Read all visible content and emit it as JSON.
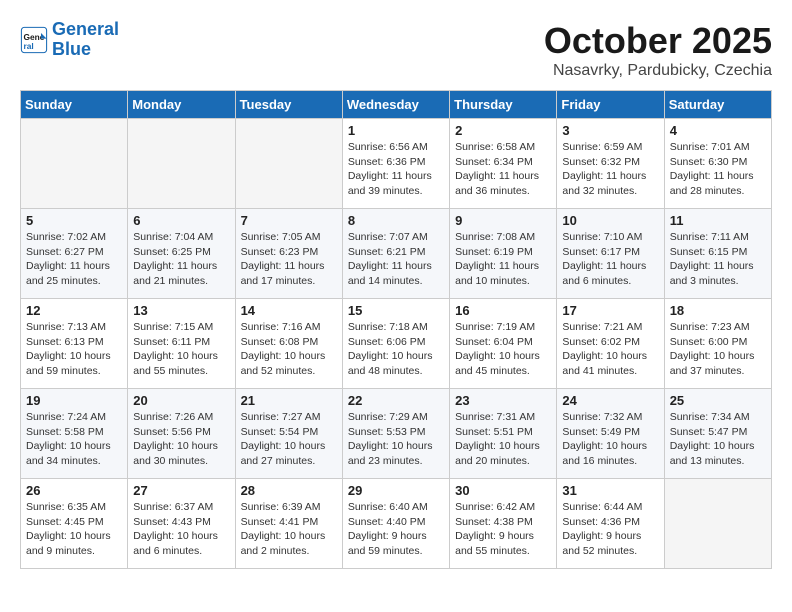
{
  "header": {
    "logo_line1": "General",
    "logo_line2": "Blue",
    "month": "October 2025",
    "location": "Nasavrky, Pardubicky, Czechia"
  },
  "days_of_week": [
    "Sunday",
    "Monday",
    "Tuesday",
    "Wednesday",
    "Thursday",
    "Friday",
    "Saturday"
  ],
  "weeks": [
    [
      {
        "day": "",
        "info": ""
      },
      {
        "day": "",
        "info": ""
      },
      {
        "day": "",
        "info": ""
      },
      {
        "day": "1",
        "info": "Sunrise: 6:56 AM\nSunset: 6:36 PM\nDaylight: 11 hours\nand 39 minutes."
      },
      {
        "day": "2",
        "info": "Sunrise: 6:58 AM\nSunset: 6:34 PM\nDaylight: 11 hours\nand 36 minutes."
      },
      {
        "day": "3",
        "info": "Sunrise: 6:59 AM\nSunset: 6:32 PM\nDaylight: 11 hours\nand 32 minutes."
      },
      {
        "day": "4",
        "info": "Sunrise: 7:01 AM\nSunset: 6:30 PM\nDaylight: 11 hours\nand 28 minutes."
      }
    ],
    [
      {
        "day": "5",
        "info": "Sunrise: 7:02 AM\nSunset: 6:27 PM\nDaylight: 11 hours\nand 25 minutes."
      },
      {
        "day": "6",
        "info": "Sunrise: 7:04 AM\nSunset: 6:25 PM\nDaylight: 11 hours\nand 21 minutes."
      },
      {
        "day": "7",
        "info": "Sunrise: 7:05 AM\nSunset: 6:23 PM\nDaylight: 11 hours\nand 17 minutes."
      },
      {
        "day": "8",
        "info": "Sunrise: 7:07 AM\nSunset: 6:21 PM\nDaylight: 11 hours\nand 14 minutes."
      },
      {
        "day": "9",
        "info": "Sunrise: 7:08 AM\nSunset: 6:19 PM\nDaylight: 11 hours\nand 10 minutes."
      },
      {
        "day": "10",
        "info": "Sunrise: 7:10 AM\nSunset: 6:17 PM\nDaylight: 11 hours\nand 6 minutes."
      },
      {
        "day": "11",
        "info": "Sunrise: 7:11 AM\nSunset: 6:15 PM\nDaylight: 11 hours\nand 3 minutes."
      }
    ],
    [
      {
        "day": "12",
        "info": "Sunrise: 7:13 AM\nSunset: 6:13 PM\nDaylight: 10 hours\nand 59 minutes."
      },
      {
        "day": "13",
        "info": "Sunrise: 7:15 AM\nSunset: 6:11 PM\nDaylight: 10 hours\nand 55 minutes."
      },
      {
        "day": "14",
        "info": "Sunrise: 7:16 AM\nSunset: 6:08 PM\nDaylight: 10 hours\nand 52 minutes."
      },
      {
        "day": "15",
        "info": "Sunrise: 7:18 AM\nSunset: 6:06 PM\nDaylight: 10 hours\nand 48 minutes."
      },
      {
        "day": "16",
        "info": "Sunrise: 7:19 AM\nSunset: 6:04 PM\nDaylight: 10 hours\nand 45 minutes."
      },
      {
        "day": "17",
        "info": "Sunrise: 7:21 AM\nSunset: 6:02 PM\nDaylight: 10 hours\nand 41 minutes."
      },
      {
        "day": "18",
        "info": "Sunrise: 7:23 AM\nSunset: 6:00 PM\nDaylight: 10 hours\nand 37 minutes."
      }
    ],
    [
      {
        "day": "19",
        "info": "Sunrise: 7:24 AM\nSunset: 5:58 PM\nDaylight: 10 hours\nand 34 minutes."
      },
      {
        "day": "20",
        "info": "Sunrise: 7:26 AM\nSunset: 5:56 PM\nDaylight: 10 hours\nand 30 minutes."
      },
      {
        "day": "21",
        "info": "Sunrise: 7:27 AM\nSunset: 5:54 PM\nDaylight: 10 hours\nand 27 minutes."
      },
      {
        "day": "22",
        "info": "Sunrise: 7:29 AM\nSunset: 5:53 PM\nDaylight: 10 hours\nand 23 minutes."
      },
      {
        "day": "23",
        "info": "Sunrise: 7:31 AM\nSunset: 5:51 PM\nDaylight: 10 hours\nand 20 minutes."
      },
      {
        "day": "24",
        "info": "Sunrise: 7:32 AM\nSunset: 5:49 PM\nDaylight: 10 hours\nand 16 minutes."
      },
      {
        "day": "25",
        "info": "Sunrise: 7:34 AM\nSunset: 5:47 PM\nDaylight: 10 hours\nand 13 minutes."
      }
    ],
    [
      {
        "day": "26",
        "info": "Sunrise: 6:35 AM\nSunset: 4:45 PM\nDaylight: 10 hours\nand 9 minutes."
      },
      {
        "day": "27",
        "info": "Sunrise: 6:37 AM\nSunset: 4:43 PM\nDaylight: 10 hours\nand 6 minutes."
      },
      {
        "day": "28",
        "info": "Sunrise: 6:39 AM\nSunset: 4:41 PM\nDaylight: 10 hours\nand 2 minutes."
      },
      {
        "day": "29",
        "info": "Sunrise: 6:40 AM\nSunset: 4:40 PM\nDaylight: 9 hours\nand 59 minutes."
      },
      {
        "day": "30",
        "info": "Sunrise: 6:42 AM\nSunset: 4:38 PM\nDaylight: 9 hours\nand 55 minutes."
      },
      {
        "day": "31",
        "info": "Sunrise: 6:44 AM\nSunset: 4:36 PM\nDaylight: 9 hours\nand 52 minutes."
      },
      {
        "day": "",
        "info": ""
      }
    ]
  ]
}
